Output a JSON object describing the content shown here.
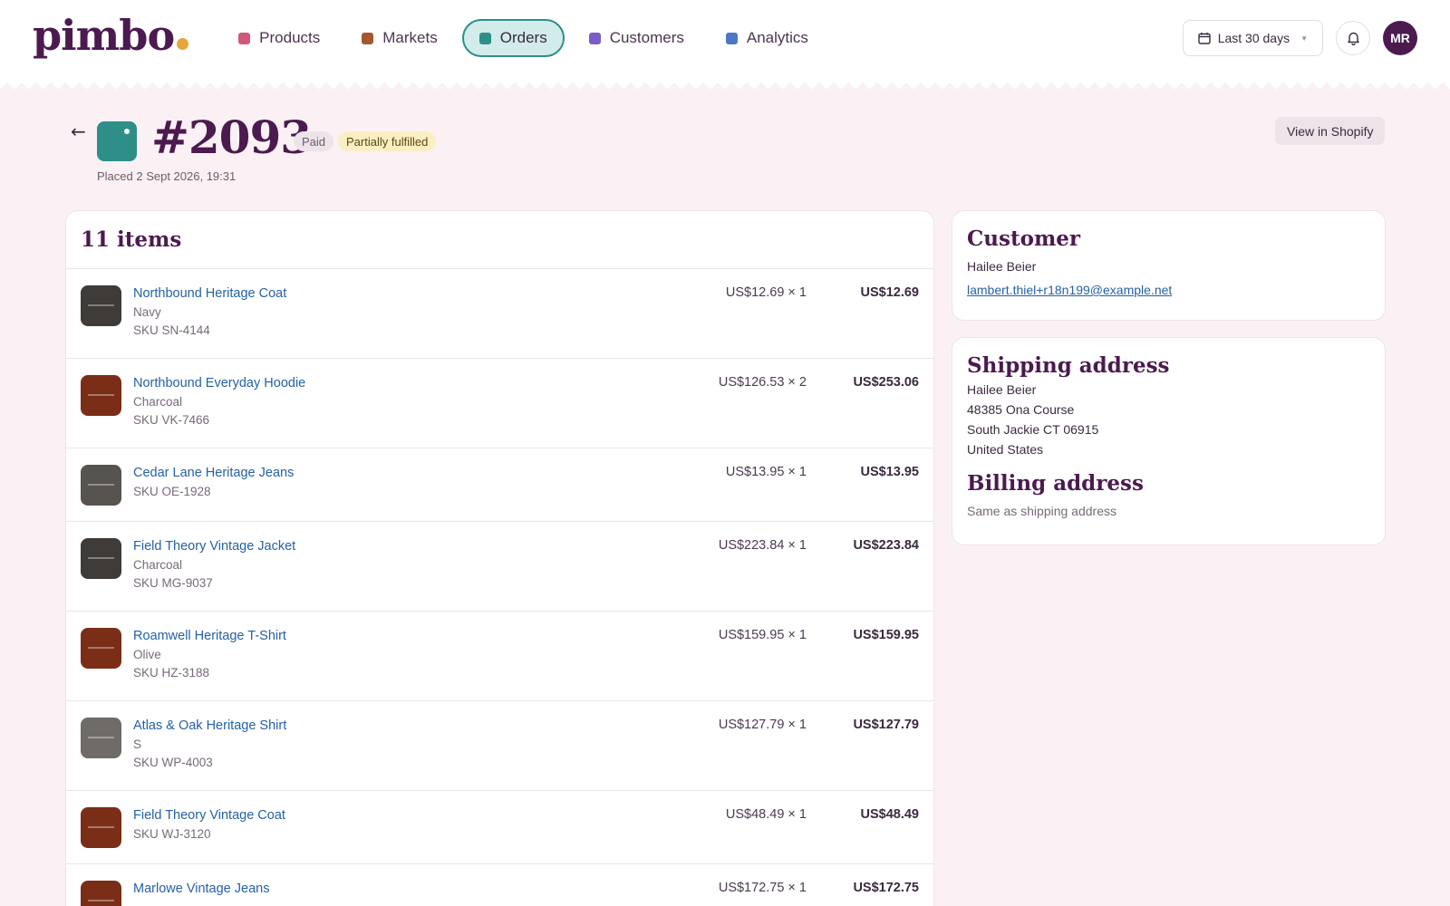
{
  "brand": {
    "name": "pimbo"
  },
  "nav": {
    "items": [
      {
        "label": "Products",
        "color": "#d0587a",
        "active": false
      },
      {
        "label": "Markets",
        "color": "#a5572e",
        "active": false
      },
      {
        "label": "Orders",
        "color": "#2d8f88",
        "active": true
      },
      {
        "label": "Customers",
        "color": "#7c5cc9",
        "active": false
      },
      {
        "label": "Analytics",
        "color": "#4a78c4",
        "active": false
      }
    ]
  },
  "topbar": {
    "date_range": "Last 30 days",
    "avatar_initials": "MR"
  },
  "order": {
    "number": "#2093",
    "payment_badge": "Paid",
    "fulfillment_badge": "Partially fulfilled",
    "placed": "Placed 2 Sept 2026, 19:31",
    "view_in_shopify": "View in Shopify",
    "accent": "#2d8f88"
  },
  "items": {
    "heading": "11 items",
    "rows": [
      {
        "name": "Northbound Heritage Coat",
        "variant": "Navy",
        "sku": "SKU SN-4144",
        "price": "US$12.69 × 1",
        "total": "US$12.69",
        "thumb_color": "#3e3b38"
      },
      {
        "name": "Northbound Everyday Hoodie",
        "variant": "Charcoal",
        "sku": "SKU VK-7466",
        "price": "US$126.53 × 2",
        "total": "US$253.06",
        "thumb_color": "#7a2e17"
      },
      {
        "name": "Cedar Lane Heritage Jeans",
        "variant": "",
        "sku": "SKU OE-1928",
        "price": "US$13.95 × 1",
        "total": "US$13.95",
        "thumb_color": "#57534f"
      },
      {
        "name": "Field Theory Vintage Jacket",
        "variant": "Charcoal",
        "sku": "SKU MG-9037",
        "price": "US$223.84 × 1",
        "total": "US$223.84",
        "thumb_color": "#3e3b38"
      },
      {
        "name": "Roamwell Heritage T-Shirt",
        "variant": "Olive",
        "sku": "SKU HZ-3188",
        "price": "US$159.95 × 1",
        "total": "US$159.95",
        "thumb_color": "#7a2e17"
      },
      {
        "name": "Atlas & Oak Heritage Shirt",
        "variant": "S",
        "sku": "SKU WP-4003",
        "price": "US$127.79 × 1",
        "total": "US$127.79",
        "thumb_color": "#6f6b67"
      },
      {
        "name": "Field Theory Vintage Coat",
        "variant": "",
        "sku": "SKU WJ-3120",
        "price": "US$48.49 × 1",
        "total": "US$48.49",
        "thumb_color": "#7a2e17"
      },
      {
        "name": "Marlowe Vintage Jeans",
        "variant": "",
        "sku": "",
        "price": "US$172.75 × 1",
        "total": "US$172.75",
        "thumb_color": "#7a2e17"
      }
    ]
  },
  "customer": {
    "heading": "Customer",
    "name": "Hailee Beier",
    "email": "lambert.thiel+r18n199@example.net"
  },
  "shipping": {
    "heading": "Shipping address",
    "name": "Hailee Beier",
    "line1": "48385 Ona Course",
    "line2": "South Jackie CT 06915",
    "country": "United States"
  },
  "billing": {
    "heading": "Billing address",
    "note": "Same as shipping address"
  }
}
